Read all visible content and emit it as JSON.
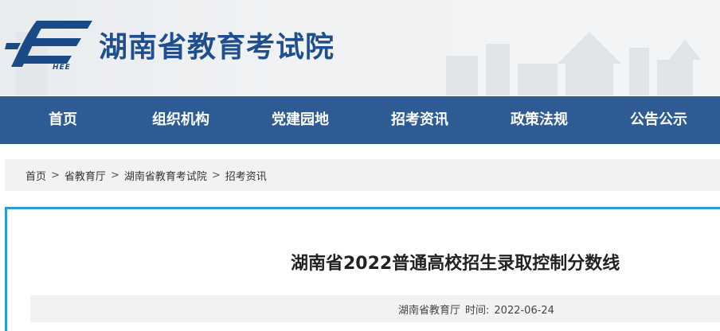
{
  "header": {
    "logo_text": "HEE",
    "site_title": "湖南省教育考试院"
  },
  "nav": {
    "items": [
      {
        "label": "首页"
      },
      {
        "label": "组织机构"
      },
      {
        "label": "党建园地"
      },
      {
        "label": "招考资讯"
      },
      {
        "label": "政策法规"
      },
      {
        "label": "公告公示"
      }
    ]
  },
  "breadcrumb": {
    "items": [
      "首页",
      "省教育厅",
      "湖南省教育考试院",
      "招考资讯"
    ],
    "separator": ">"
  },
  "article": {
    "title": "湖南省2022普通高校招生录取控制分数线",
    "source": "湖南省教育厅",
    "time_label": "时间:",
    "date": "2022-06-24"
  },
  "colors": {
    "nav_bg": "#2e5b94",
    "title_blue": "#1f4f8f",
    "accent_border": "#2b9bd8"
  }
}
